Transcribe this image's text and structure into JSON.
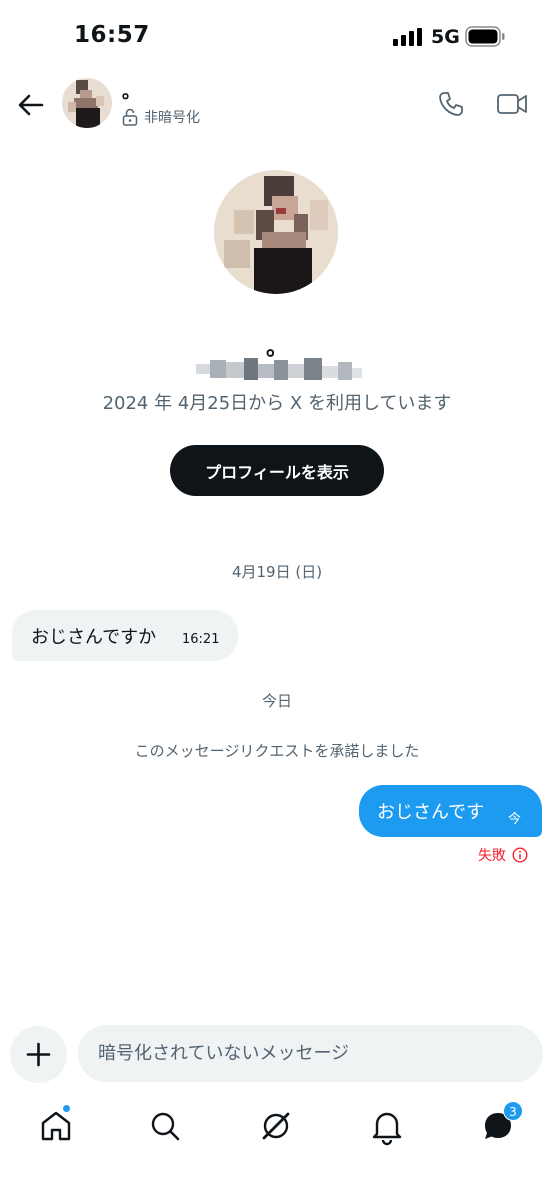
{
  "status_bar": {
    "time": "16:57",
    "network": "5G"
  },
  "header": {
    "name": "。",
    "encryption_label": "非暗号化"
  },
  "profile": {
    "name": "。",
    "joined_text": "2024 年 4月25日から X を利用しています",
    "view_profile_label": "プロフィールを表示"
  },
  "chat": {
    "date_separator_1": "4月19日 (日)",
    "incoming": {
      "text": "おじさんですか",
      "time": "16:21"
    },
    "date_separator_2": "今日",
    "system_message": "このメッセージリクエストを承諾しました",
    "outgoing": {
      "text": "おじさんです",
      "time": "今",
      "status": "失敗"
    }
  },
  "composer": {
    "placeholder": "暗号化されていないメッセージ"
  },
  "bottom_nav": {
    "dm_badge": "3"
  },
  "colors": {
    "accent": "#1d9bf0",
    "error": "#f4212e",
    "primary_button": "#0f1419",
    "secondary_text": "#536471"
  },
  "icons": [
    "back-arrow-icon",
    "lock-open-icon",
    "phone-icon",
    "video-icon",
    "plus-icon",
    "home-icon",
    "search-icon",
    "grok-icon",
    "bell-icon",
    "messages-icon",
    "alert-circle-icon"
  ]
}
